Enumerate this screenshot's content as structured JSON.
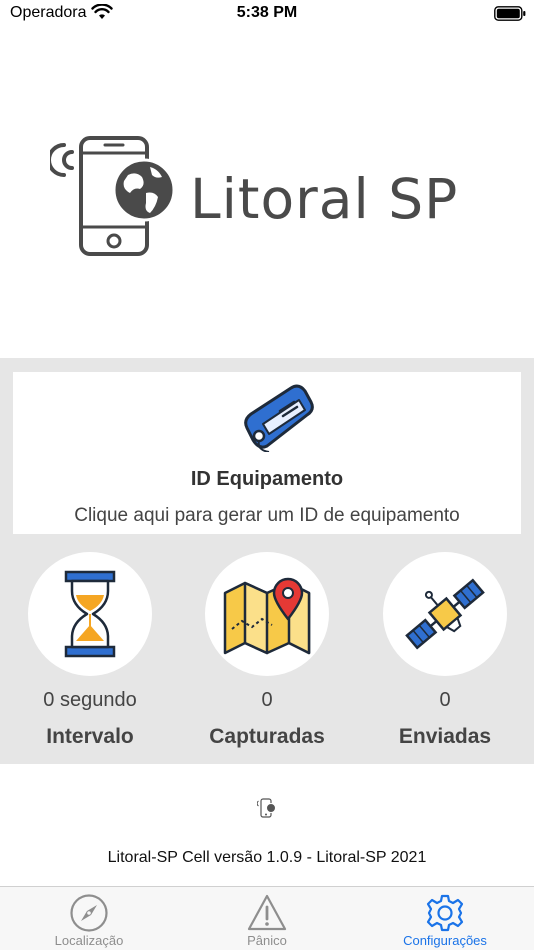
{
  "status_bar": {
    "carrier": "Operadora",
    "time": "5:38 PM"
  },
  "logo": {
    "text": "Litoral SP",
    "icon": "phone-globe-icon"
  },
  "device_id": {
    "icon": "tag-icon",
    "title": "ID Equipamento",
    "subtitle": "Clique aqui para gerar um ID de equipamento"
  },
  "stats": [
    {
      "icon": "hourglass-icon",
      "value": "0 segundo",
      "label": "Intervalo"
    },
    {
      "icon": "map-pin-icon",
      "value": "0",
      "label": "Capturadas"
    },
    {
      "icon": "satellite-icon",
      "value": "0",
      "label": "Enviadas"
    }
  ],
  "footer": {
    "icon": "phone-globe-small-icon",
    "version_text": "Litoral-SP Cell versão 1.0.9 - Litoral-SP 2021"
  },
  "tabs": [
    {
      "label": "Localização",
      "icon": "compass-icon",
      "active": false
    },
    {
      "label": "Pânico",
      "icon": "warning-icon",
      "active": false
    },
    {
      "label": "Configurações",
      "icon": "gear-icon",
      "active": true
    }
  ],
  "colors": {
    "accent": "#1a73e8",
    "inactive_tab": "#8e8e8e",
    "gray_background": "#e6e6e6",
    "tag_blue": "#2f6fd0",
    "hourglass_sand": "#f5a623",
    "map_yellow": "#f7c948",
    "pin_red": "#e53935"
  }
}
